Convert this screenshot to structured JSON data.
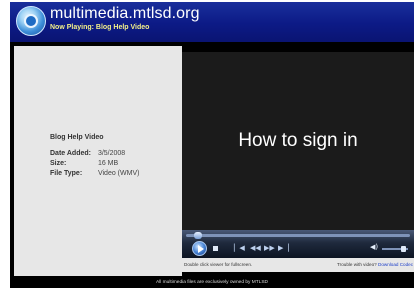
{
  "header": {
    "site_title": "multimedia.mtlsd.org",
    "now_playing": "Now Playing: Blog Help Video"
  },
  "info": {
    "title": "Blog Help Video",
    "rows": [
      {
        "label": "Date Added:",
        "value": "3/5/2008"
      },
      {
        "label": "Size:",
        "value": "16 MB"
      },
      {
        "label": "File Type:",
        "value": "Video (WMV)"
      }
    ]
  },
  "video": {
    "slide_text": "How to sign in",
    "seek_progress": 0.04
  },
  "below_video": {
    "left_hint": "Double click viewer for fullscreen.",
    "trouble_text": "Trouble with video?",
    "download_link": "Download Codec"
  },
  "footer": {
    "text": "All multimedia files are exclusively owned by MTLSD"
  },
  "colors": {
    "header_blue": "#0c1a86",
    "now_playing_yellow": "#f3f08a",
    "panel_gray": "#e7e7e7",
    "link_blue": "#1a3cc8"
  },
  "icons": [
    "site-logo-icon",
    "play-icon",
    "stop-icon",
    "previous-icon",
    "rewind-icon",
    "fast-forward-icon",
    "next-icon",
    "volume-icon"
  ]
}
